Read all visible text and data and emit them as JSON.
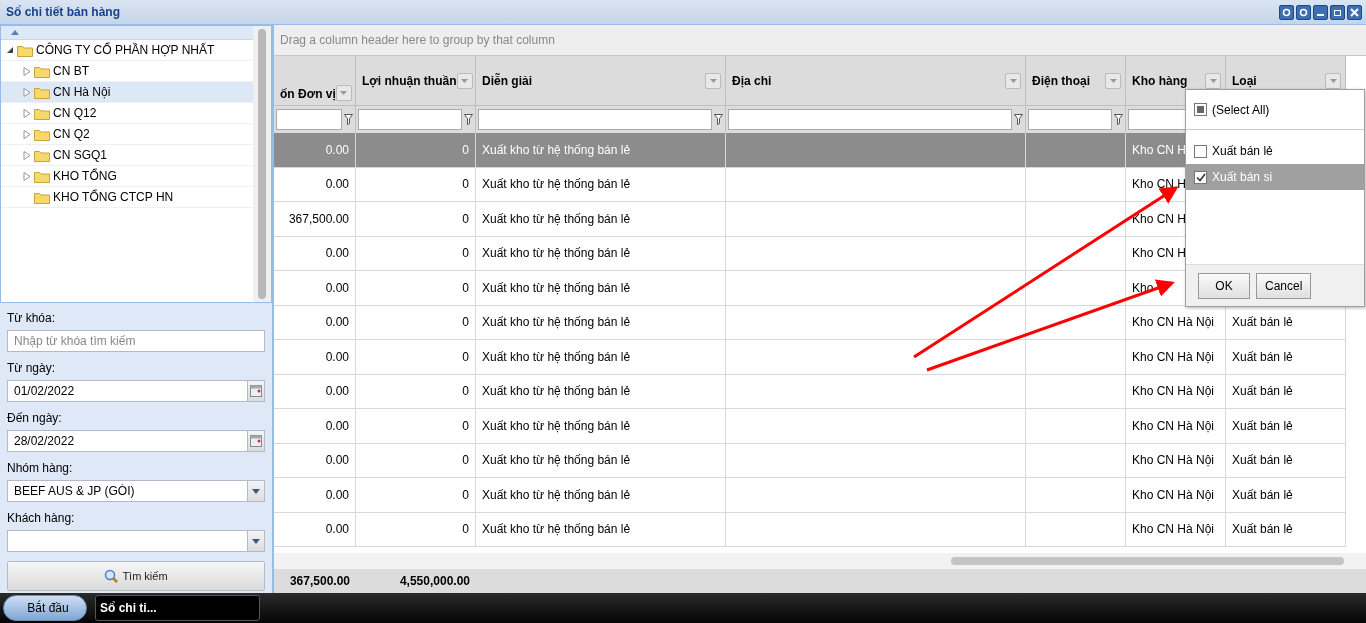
{
  "window": {
    "title": "Sổ chi tiết bán hàng"
  },
  "tree": {
    "label": "CÔNG TY CỔ PHẦN HỢP NHẤT",
    "expanded": true,
    "children": [
      {
        "label": "CN BT",
        "selected": false,
        "expandable": true
      },
      {
        "label": "CN Hà Nội",
        "selected": true,
        "expandable": true
      },
      {
        "label": "CN Q12",
        "selected": false,
        "expandable": true
      },
      {
        "label": "CN Q2",
        "selected": false,
        "expandable": true
      },
      {
        "label": "CN SGQ1",
        "selected": false,
        "expandable": true
      },
      {
        "label": "KHO TỔNG",
        "selected": false,
        "expandable": true
      },
      {
        "label": "KHO TỔNG CTCP HN",
        "selected": false,
        "expandable": false
      }
    ]
  },
  "form": {
    "fields": [
      {
        "kind": "text",
        "label": "Từ khóa:",
        "placeholder": "Nhập từ khóa tìm kiếm"
      },
      {
        "kind": "date",
        "label": "Từ ngày:",
        "value": "01/02/2022"
      },
      {
        "kind": "date",
        "label": "Đến ngày:",
        "value": "28/02/2022"
      },
      {
        "kind": "select",
        "label": "Nhóm hàng:",
        "value": "BEEF AUS & JP (GÓI)"
      },
      {
        "kind": "select",
        "label": "Khách hàng:"
      }
    ],
    "search_button": "Tìm kiếm"
  },
  "grid": {
    "group_hint": "Drag a column header here to group by that column",
    "columns": [
      "ốn Đơn vị",
      "Lợi nhuận thuần",
      "Diễn giải",
      "Địa chỉ",
      "Điện thoại",
      "Kho hàng",
      "Loại"
    ],
    "rows": [
      {
        "selected": true,
        "cells": [
          "0.00",
          "0",
          "Xuất kho từ hệ thống bán lẻ",
          "",
          "",
          "Kho CN H",
          ""
        ]
      },
      {
        "selected": false,
        "cells": [
          "0.00",
          "0",
          "Xuất kho từ hệ thống bán lẻ",
          "",
          "",
          "Kho CN H",
          ""
        ]
      },
      {
        "selected": false,
        "cells": [
          "367,500.00",
          "0",
          "Xuất kho từ hệ thống bán lẻ",
          "",
          "",
          "Kho CN H",
          ""
        ]
      },
      {
        "selected": false,
        "cells": [
          "0.00",
          "0",
          "Xuất kho từ hệ thống bán lẻ",
          "",
          "",
          "Kho CN H",
          ""
        ]
      },
      {
        "selected": false,
        "cells": [
          "0.00",
          "0",
          "Xuất kho từ hệ thống bán lẻ",
          "",
          "",
          "Kho",
          ""
        ]
      },
      {
        "selected": false,
        "cells": [
          "0.00",
          "0",
          "Xuất kho từ hệ thống bán lẻ",
          "",
          "",
          "Kho CN Hà Nội",
          "Xuất bán lẻ"
        ]
      },
      {
        "selected": false,
        "cells": [
          "0.00",
          "0",
          "Xuất kho từ hệ thống bán lẻ",
          "",
          "",
          "Kho CN Hà Nội",
          "Xuất bán lẻ"
        ]
      },
      {
        "selected": false,
        "cells": [
          "0.00",
          "0",
          "Xuất kho từ hệ thống bán lẻ",
          "",
          "",
          "Kho CN Hà Nội",
          "Xuất bán lẻ"
        ]
      },
      {
        "selected": false,
        "cells": [
          "0.00",
          "0",
          "Xuất kho từ hệ thống bán lẻ",
          "",
          "",
          "Kho CN Hà Nội",
          "Xuất bán lẻ"
        ]
      },
      {
        "selected": false,
        "cells": [
          "0.00",
          "0",
          "Xuất kho từ hệ thống bán lẻ",
          "",
          "",
          "Kho CN Hà Nội",
          "Xuất bán lẻ"
        ]
      },
      {
        "selected": false,
        "cells": [
          "0.00",
          "0",
          "Xuất kho từ hệ thống bán lẻ",
          "",
          "",
          "Kho CN Hà Nội",
          "Xuất bán lẻ"
        ]
      },
      {
        "selected": false,
        "cells": [
          "0.00",
          "0",
          "Xuất kho từ hệ thống bán lẻ",
          "",
          "",
          "Kho CN Hà Nội",
          "Xuất bán lẻ"
        ]
      }
    ],
    "totals": [
      "367,500.00",
      "4,550,000.00"
    ]
  },
  "filter_popup": {
    "select_all": {
      "label": "(Select All)",
      "indeterminate": true
    },
    "options": [
      {
        "label": "Xuất bán lẻ",
        "checked": false,
        "selected": false
      },
      {
        "label": "Xuất bán si",
        "checked": true,
        "selected": true
      }
    ],
    "buttons": [
      "OK",
      "Cancel"
    ]
  },
  "taskbar": {
    "start": "Bắt đầu",
    "tasks": [
      "Sổ chi ti..."
    ]
  }
}
